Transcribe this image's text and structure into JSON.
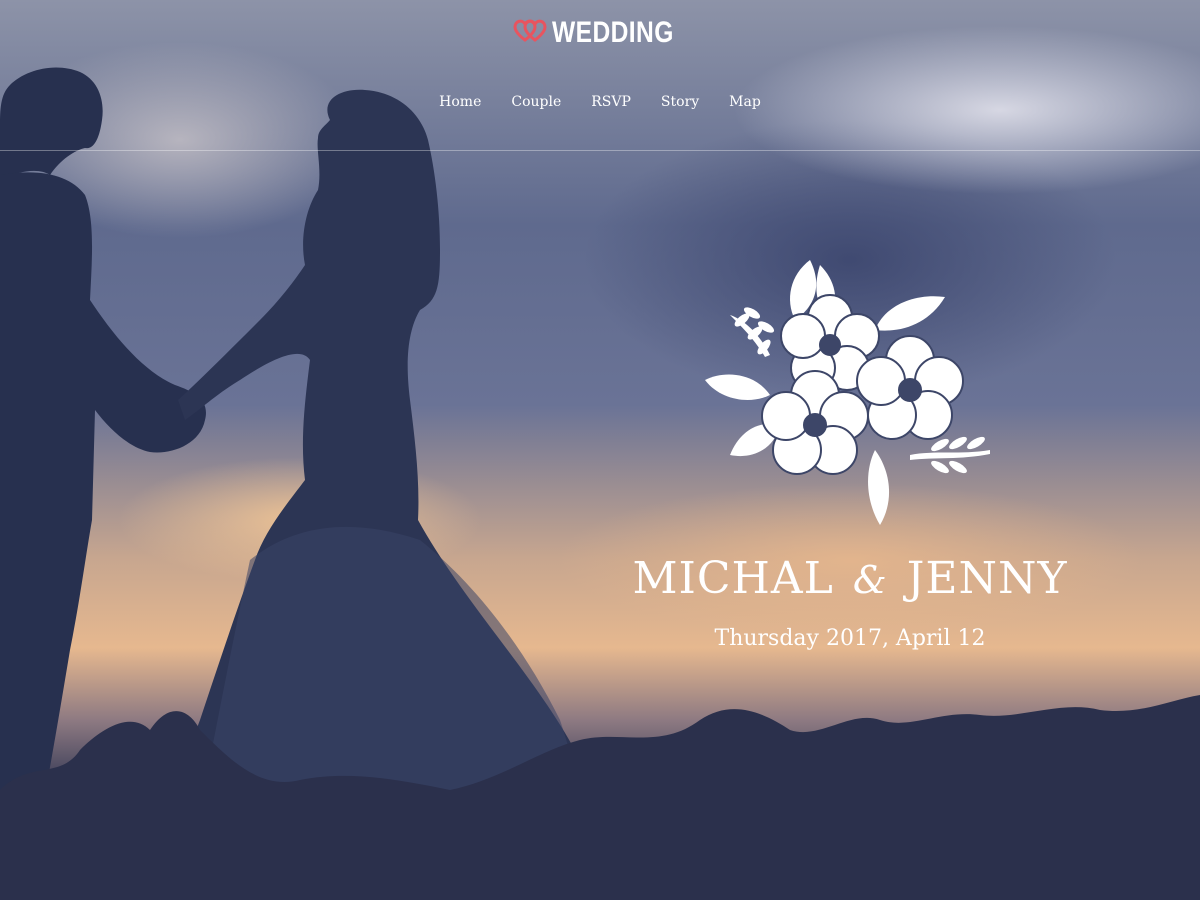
{
  "brand": {
    "name": "WEDDING",
    "accent_color": "#e8545f",
    "icon": "double-heart-icon"
  },
  "nav": {
    "items": [
      {
        "label": "Home"
      },
      {
        "label": "Couple"
      },
      {
        "label": "RSVP"
      },
      {
        "label": "Story"
      },
      {
        "label": "Map"
      }
    ]
  },
  "hero": {
    "name_1": "MICHAL",
    "ampersand": "&",
    "name_2": "JENNY",
    "date": "Thursday 2017, April 12",
    "ornament_icon": "floral-ornament-icon",
    "text_color": "#ffffff"
  }
}
